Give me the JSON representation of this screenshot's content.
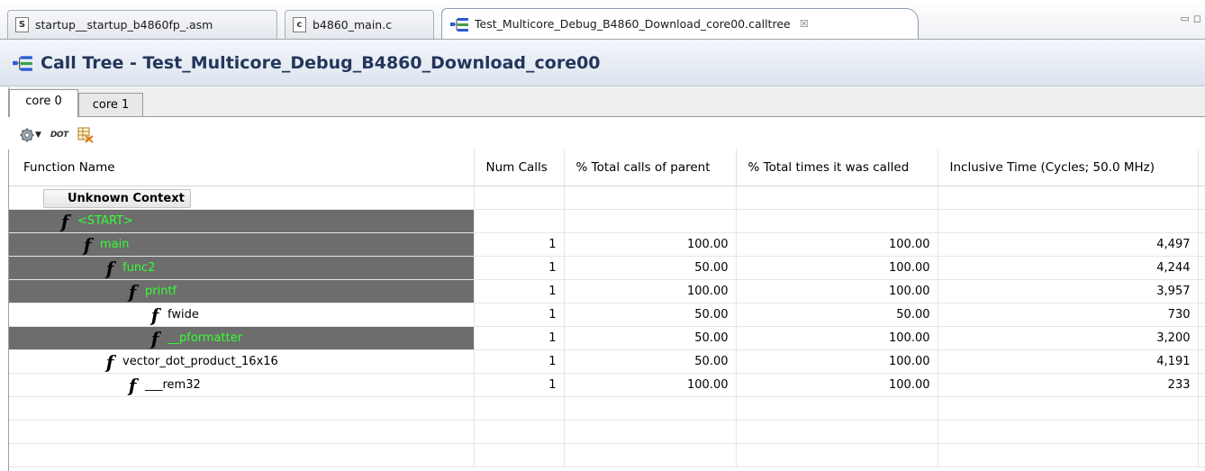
{
  "editor_tabs": [
    {
      "icon": "S",
      "label": "startup__startup_b4860fp_.asm"
    },
    {
      "icon": "c",
      "label": "b4860_main.c"
    },
    {
      "icon": "calltree",
      "label": "Test_Multicore_Debug_B4860_Download_core00.calltree",
      "close": "☒"
    }
  ],
  "view": {
    "title": "Call Tree - Test_Multicore_Debug_B4860_Download_core00"
  },
  "core_tabs": [
    "core 0",
    "core 1"
  ],
  "toolbar": {
    "dot_label": "DOT"
  },
  "table": {
    "columns": [
      "Function Name",
      "Num Calls",
      "% Total calls of parent",
      "% Total times it was called",
      "Inclusive Time (Cycles; 50.0 MHz)"
    ],
    "context_label": "Unknown Context",
    "rows": [
      {
        "name": "<START>",
        "level": 0,
        "highlighted": true,
        "num_calls": "",
        "pct_parent": "",
        "pct_called": "",
        "inclusive": ""
      },
      {
        "name": "main",
        "level": 1,
        "highlighted": true,
        "num_calls": "1",
        "pct_parent": "100.00",
        "pct_called": "100.00",
        "inclusive": "4,497"
      },
      {
        "name": "func2",
        "level": 2,
        "highlighted": true,
        "num_calls": "1",
        "pct_parent": "50.00",
        "pct_called": "100.00",
        "inclusive": "4,244"
      },
      {
        "name": "printf",
        "level": 3,
        "highlighted": true,
        "num_calls": "1",
        "pct_parent": "100.00",
        "pct_called": "100.00",
        "inclusive": "3,957"
      },
      {
        "name": "fwide",
        "level": 4,
        "highlighted": false,
        "num_calls": "1",
        "pct_parent": "50.00",
        "pct_called": "50.00",
        "inclusive": "730"
      },
      {
        "name": "__pformatter",
        "level": 4,
        "highlighted": true,
        "num_calls": "1",
        "pct_parent": "50.00",
        "pct_called": "100.00",
        "inclusive": "3,200"
      },
      {
        "name": "vector_dot_product_16x16",
        "level": 2,
        "highlighted": false,
        "num_calls": "1",
        "pct_parent": "50.00",
        "pct_called": "100.00",
        "inclusive": "4,191"
      },
      {
        "name": "___rem32",
        "level": 3,
        "highlighted": false,
        "num_calls": "1",
        "pct_parent": "100.00",
        "pct_called": "100.00",
        "inclusive": "233"
      }
    ]
  },
  "colors": {
    "highlight_row": "#6d6d6d",
    "highlight_text": "#33ff33",
    "title_text": "#24365a"
  },
  "icons": [
    "asm-file-icon",
    "c-file-icon",
    "calltree-icon",
    "close-icon",
    "gear-icon",
    "dropdown-arrow-icon",
    "dot-export-icon",
    "export-table-icon",
    "function-icon"
  ]
}
